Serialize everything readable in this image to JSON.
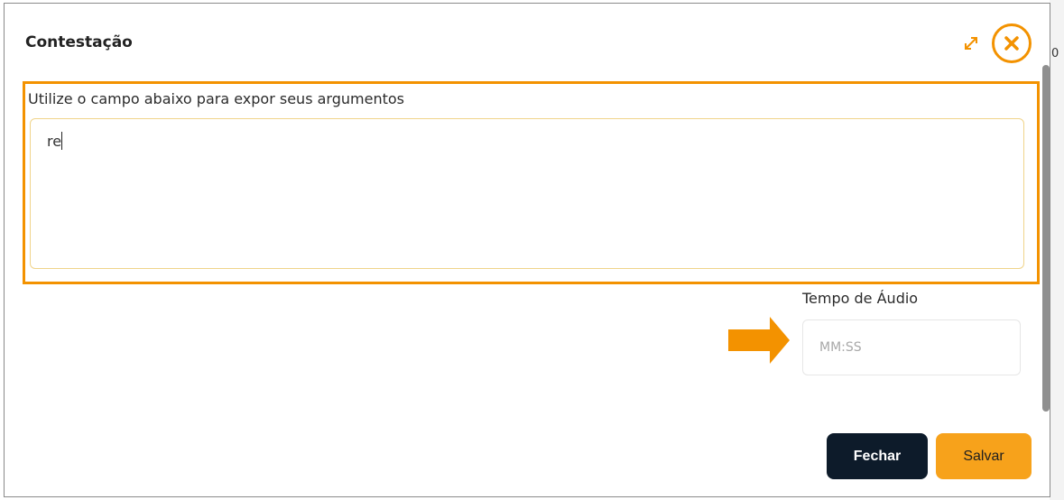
{
  "background": {
    "edge_text": "0"
  },
  "modal": {
    "title": "Contestação",
    "field_label": "Utilize o campo abaixo para expor seus argumentos",
    "textarea_value": "re",
    "audio": {
      "label": "Tempo de Áudio",
      "placeholder": "MM:SS"
    },
    "buttons": {
      "close_label": "Fechar",
      "save_label": "Salvar"
    }
  },
  "icons": {
    "expand": "expand-icon",
    "close": "close-circle-icon",
    "annotation": "arrow-right-icon"
  },
  "colors": {
    "accent": "#f39200",
    "dark_button": "#0d1b2a",
    "save_button": "#f7a21b"
  }
}
